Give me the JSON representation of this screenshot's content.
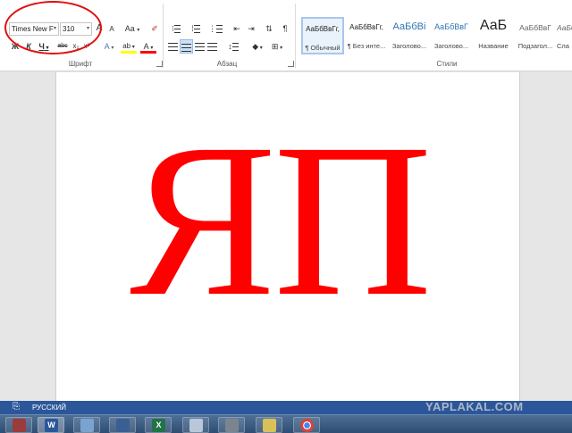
{
  "ribbon": {
    "font_group": {
      "label": "Шрифт",
      "font_name": "Times New F",
      "font_size": "310",
      "case_button": "Aa",
      "grow_font": "A",
      "shrink_font": "A",
      "bold": "Ж",
      "italic": "К",
      "underline": "Ч",
      "strikethrough": "abc",
      "subscript": "x₂",
      "superscript": "x²",
      "font_color": "A",
      "highlight": "ab"
    },
    "paragraph_group": {
      "label": "Абзац",
      "show_marks": "¶"
    },
    "styles_group": {
      "label": "Стили",
      "items": [
        {
          "preview": "АаБбВвГг,",
          "name": "¶ Обычный"
        },
        {
          "preview": "АаБбВвГг,",
          "name": "¶ Без инте..."
        },
        {
          "preview": "АаБбВі",
          "name": "Заголово..."
        },
        {
          "preview": "АаБбВвГ",
          "name": "Заголово..."
        },
        {
          "preview": "АаБ",
          "name": "Название"
        },
        {
          "preview": "АаБбВвГ",
          "name": "Подзагол..."
        },
        {
          "preview": "АаБб",
          "name": "Сла"
        }
      ]
    }
  },
  "document": {
    "text": "ЯП",
    "text_color": "#ff0000"
  },
  "status_bar": {
    "language": "РУССКИЙ"
  },
  "watermark": "YAPLAKAL.COM",
  "taskbar": {
    "apps": [
      {
        "icon": "app-icon",
        "label": ""
      },
      {
        "icon": "word-icon",
        "label": "W"
      },
      {
        "icon": "window-icon",
        "label": ""
      },
      {
        "icon": "floppy-icon",
        "label": ""
      },
      {
        "icon": "excel-icon",
        "label": "X"
      },
      {
        "icon": "calculator-icon",
        "label": ""
      },
      {
        "icon": "tools-icon",
        "label": ""
      },
      {
        "icon": "notes-icon",
        "label": ""
      },
      {
        "icon": "chrome-icon",
        "label": ""
      }
    ]
  }
}
